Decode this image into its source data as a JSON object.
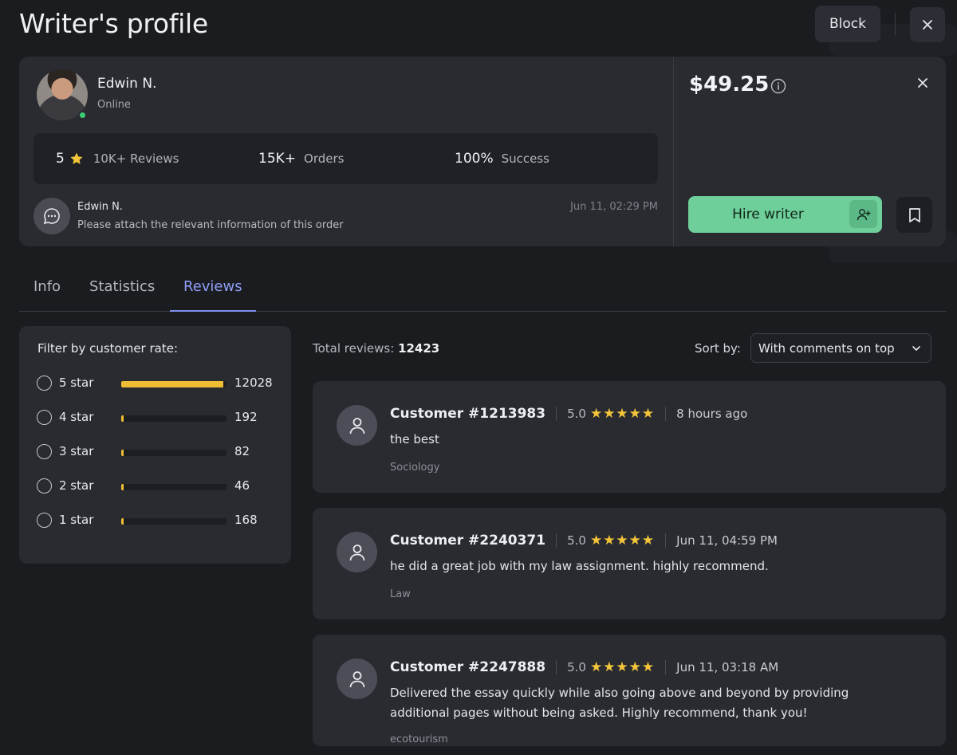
{
  "page": {
    "title": "Writer's profile"
  },
  "header": {
    "block_label": "Block"
  },
  "writer": {
    "name": "Edwin N.",
    "status": "Online",
    "rating": "5",
    "reviews_label": "10K+ Reviews",
    "orders_value": "15K+",
    "orders_label": "Orders",
    "success_value": "100%",
    "success_label": "Success"
  },
  "message": {
    "author": "Edwin N.",
    "text": "Please attach the relevant information of this order",
    "time": "Jun 11, 02:29 PM"
  },
  "offer": {
    "price": "$49.25",
    "hire_label": "Hire writer"
  },
  "tabs": [
    {
      "label": "Info",
      "active": false
    },
    {
      "label": "Statistics",
      "active": false
    },
    {
      "label": "Reviews",
      "active": true
    }
  ],
  "filter": {
    "title": "Filter by customer rate:",
    "rows": [
      {
        "label": "5 star",
        "count": "12028",
        "share": 0.967
      },
      {
        "label": "4 star",
        "count": "192",
        "share": 0.015
      },
      {
        "label": "3 star",
        "count": "82",
        "share": 0.007
      },
      {
        "label": "2 star",
        "count": "46",
        "share": 0.004
      },
      {
        "label": "1 star",
        "count": "168",
        "share": 0.014
      }
    ]
  },
  "reviews_header": {
    "total_label": "Total reviews:",
    "total_value": "12423",
    "sort_label": "Sort by:",
    "sort_value": "With comments on top"
  },
  "reviews": [
    {
      "customer": "Customer #1213983",
      "score": "5.0",
      "stars": "★★★★★",
      "date": "8 hours ago",
      "text": "the best",
      "subject": "Sociology"
    },
    {
      "customer": "Customer #2240371",
      "score": "5.0",
      "stars": "★★★★★",
      "date": "Jun 11, 04:59 PM",
      "text": "he did a great job with my law assignment. highly recommend.",
      "subject": "Law"
    },
    {
      "customer": "Customer #2247888",
      "score": "5.0",
      "stars": "★★★★★",
      "date": "Jun 11, 03:18 AM",
      "text": "Delivered the essay quickly while also going above and beyond by providing additional pages without being asked. Highly recommend, thank you!",
      "subject": "ecotourism"
    }
  ],
  "colors": {
    "accent_green": "#6fcf9a",
    "tab_active": "#8e9ef4",
    "star_yellow": "#f4c53a",
    "bar_fill": "#f0be35",
    "online": "#3dcf73"
  }
}
